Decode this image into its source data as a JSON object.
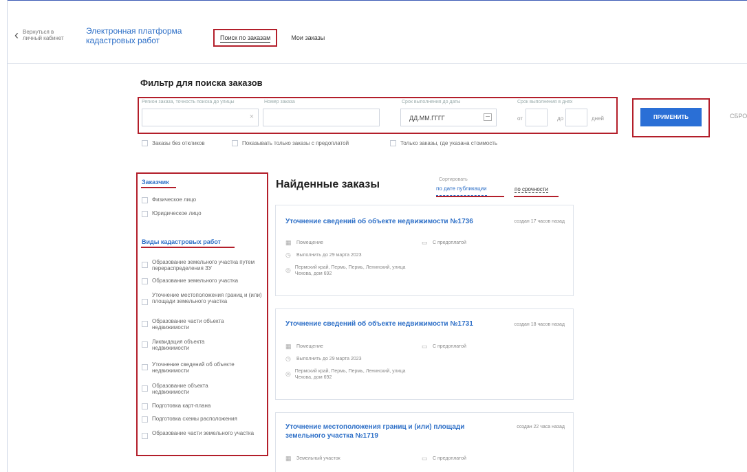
{
  "header": {
    "back_label": "Вернуться в личный кабинет",
    "brand_line1": "Электронная платформа",
    "brand_line2": "кадастровых работ",
    "tabs": [
      {
        "label": "Поиск по заказам"
      },
      {
        "label": "Мои заказы"
      }
    ]
  },
  "filter": {
    "title": "Фильтр для поиска заказов",
    "region_label": "Регион заказа, точность поиска до улицы",
    "order_number_label": "Номер заказа",
    "deadline_date_label": "Срок выполнения до даты",
    "date_placeholder": "ДД.ММ.ГГГГ",
    "deadline_days_label": "Срок выполнения в днях",
    "from_label": "от",
    "to_label": "до",
    "days_label": "дней",
    "apply_button": "ПРИМЕНИТЬ",
    "reset_button": "СБРО",
    "checkboxes": [
      "Заказы без откликов",
      "Показывать только заказы с предоплатой",
      "Только заказы, где указана стоимость"
    ]
  },
  "sidebar": {
    "customer_heading": "Заказчик",
    "customer_items": [
      "Физическое лицо",
      "Юридическое лицо"
    ],
    "works_heading": "Виды кадастровых работ",
    "works_items": [
      "Образование земельного участка путем перераспределения ЗУ",
      "Образование земельного участка",
      "Уточнение местоположения границ и (или) площади земельного участка",
      "Образование части объекта недвижимости",
      "Ликвидация объекта недвижимости",
      "Уточнение сведений об объекте недвижимости",
      "Образование объекта недвижимости",
      "Подготовка карт-плана",
      "Подготовка схемы расположения",
      "Образование части земельного участка"
    ]
  },
  "results": {
    "title": "Найденные заказы",
    "sort_label": "Сортировать",
    "sort_by_date": "по дате публикации",
    "sort_by_urgency": "по срочности",
    "cards": [
      {
        "title": "Уточнение сведений об объекте недвижимости №1736",
        "created": "создан 17 часов назад",
        "object_type": "Помещение",
        "prepayment": "С предоплатой",
        "deadline": "Выполнить до 29 марта 2023",
        "address": "Пермский край, Пермь, Пермь, Ленинский, улица Чехова, дом 692"
      },
      {
        "title": "Уточнение сведений об объекте недвижимости №1731",
        "created": "создан 18 часов назад",
        "object_type": "Помещение",
        "prepayment": "С предоплатой",
        "deadline": "Выполнить до 29 марта 2023",
        "address": "Пермский край, Пермь, Пермь, Ленинский, улица Чехова, дом 692"
      },
      {
        "title": "Уточнение местоположения границ и (или) площади земельного участка №1719",
        "created": "создан 22 часа назад",
        "object_type": "Земельный участок",
        "prepayment": "С предоплатой"
      }
    ]
  }
}
